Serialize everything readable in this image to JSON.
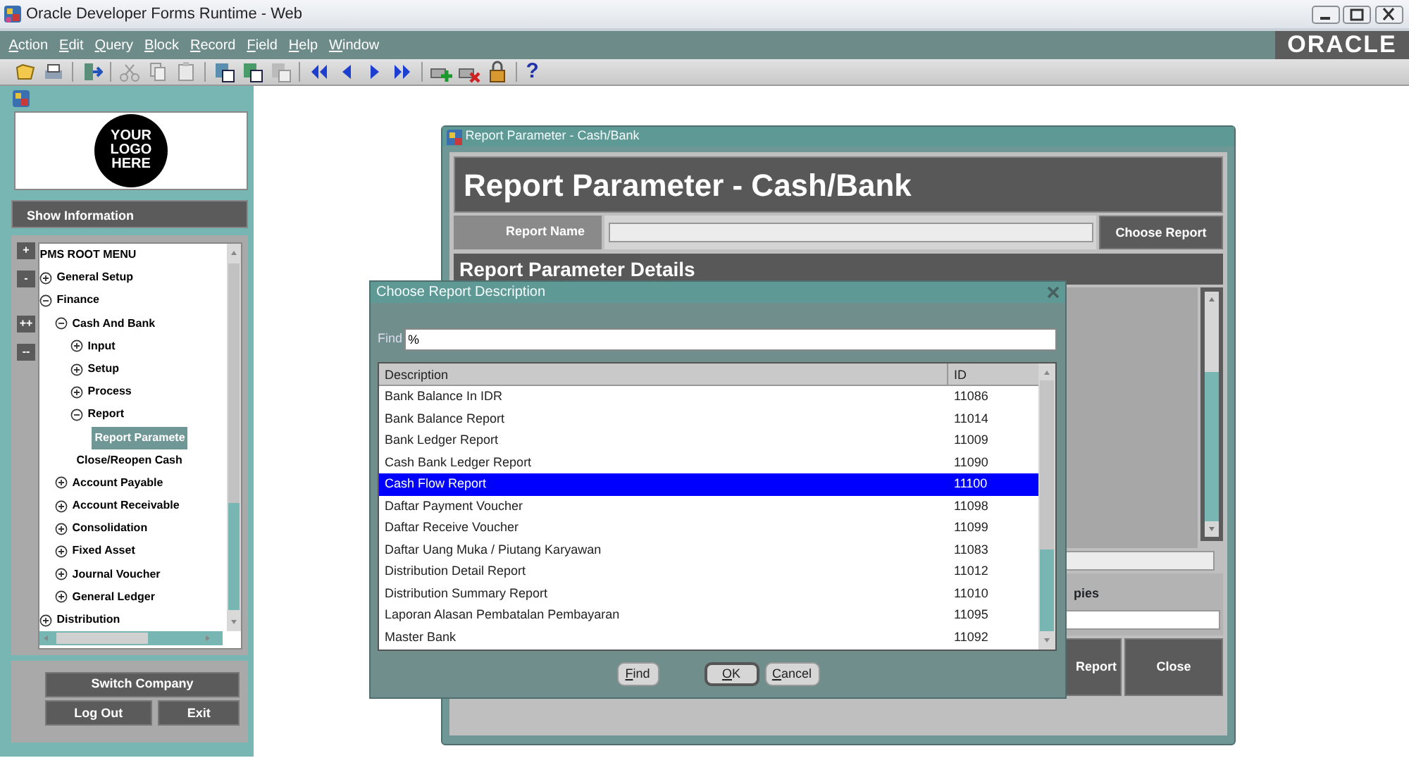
{
  "window": {
    "title": "Oracle Developer Forms Runtime - Web"
  },
  "menu": [
    "Action",
    "Edit",
    "Query",
    "Block",
    "Record",
    "Field",
    "Help",
    "Window"
  ],
  "brand": "ORACLE",
  "toolbar": {
    "help": "?"
  },
  "sidebar": {
    "logo_text": [
      "YOUR",
      "LOGO",
      "HERE"
    ],
    "show_information": "Show Information",
    "tree_buttons": [
      "+",
      "-",
      "++",
      "--"
    ],
    "tree": [
      {
        "label": "PMS ROOT MENU",
        "kind": "leaf",
        "selected": false
      },
      {
        "label": "General Setup",
        "kind": "folder",
        "expanded": false,
        "selected": false
      },
      {
        "label": "Finance",
        "kind": "folder",
        "expanded": true,
        "selected": false,
        "children": [
          {
            "label": "Cash And Bank",
            "kind": "folder",
            "expanded": true,
            "selected": false,
            "children": [
              {
                "label": "Input",
                "kind": "folder",
                "expanded": false,
                "selected": false
              },
              {
                "label": "Setup",
                "kind": "folder",
                "expanded": false,
                "selected": false
              },
              {
                "label": "Process",
                "kind": "folder",
                "expanded": false,
                "selected": false
              },
              {
                "label": "Report",
                "kind": "folder",
                "expanded": true,
                "selected": false,
                "children": [
                  {
                    "label": "Report Paramete",
                    "kind": "leaf",
                    "selected": true
                  }
                ]
              },
              {
                "label": "Close/Reopen Cash",
                "kind": "leaf",
                "selected": false
              }
            ]
          },
          {
            "label": "Account Payable",
            "kind": "folder",
            "expanded": false,
            "selected": false
          },
          {
            "label": "Account Receivable",
            "kind": "folder",
            "expanded": false,
            "selected": false
          },
          {
            "label": "Consolidation",
            "kind": "folder",
            "expanded": false,
            "selected": false
          },
          {
            "label": "Fixed Asset",
            "kind": "folder",
            "expanded": false,
            "selected": false
          },
          {
            "label": "Journal Voucher",
            "kind": "folder",
            "expanded": false,
            "selected": false
          },
          {
            "label": "General Ledger",
            "kind": "folder",
            "expanded": false,
            "selected": false
          }
        ]
      },
      {
        "label": "Distribution",
        "kind": "folder",
        "expanded": false,
        "selected": false
      }
    ],
    "buttons": [
      "Switch Company",
      "Log Out",
      "Exit"
    ]
  },
  "report_window": {
    "title": "Report Parameter - Cash/Bank",
    "heading": "Report Parameter - Cash/Bank",
    "report_name_label": "Report Name",
    "choose_report_button": "Choose Report",
    "details_heading": "Report Parameter Details",
    "copies_label": "pies",
    "report_button": "Report",
    "close_button": "Close"
  },
  "dialog": {
    "title": "Choose Report Description",
    "find_label": "Find",
    "find_value": "%",
    "columns": [
      "Description",
      "ID"
    ],
    "rows": [
      {
        "description": "Bank Balance In IDR",
        "id": "11086",
        "selected": false
      },
      {
        "description": "Bank Balance Report",
        "id": "11014",
        "selected": false
      },
      {
        "description": "Bank Ledger Report",
        "id": "11009",
        "selected": false
      },
      {
        "description": "Cash Bank Ledger Report",
        "id": "11090",
        "selected": false
      },
      {
        "description": "Cash Flow Report",
        "id": "11100",
        "selected": true
      },
      {
        "description": "Daftar Payment Voucher",
        "id": "11098",
        "selected": false
      },
      {
        "description": "Daftar Receive Voucher",
        "id": "11099",
        "selected": false
      },
      {
        "description": "Daftar Uang Muka / Piutang Karyawan",
        "id": "11083",
        "selected": false
      },
      {
        "description": "Distribution Detail Report",
        "id": "11012",
        "selected": false
      },
      {
        "description": "Distribution Summary Report",
        "id": "11010",
        "selected": false
      },
      {
        "description": "Laporan Alasan Pembatalan Pembayaran",
        "id": "11095",
        "selected": false
      },
      {
        "description": "Master Bank",
        "id": "11092",
        "selected": false
      }
    ],
    "buttons": [
      {
        "label": "Find",
        "default": false
      },
      {
        "label": "OK",
        "default": true
      },
      {
        "label": "Cancel",
        "default": false
      }
    ]
  }
}
